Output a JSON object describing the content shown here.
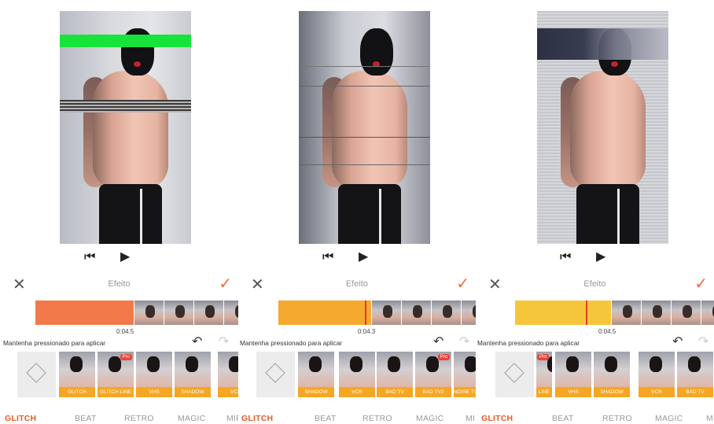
{
  "colors": {
    "accent": "#f06a3a",
    "tag": "#f5a623",
    "pro_badge": "#e8453c",
    "playhead": "#e53a2a"
  },
  "icons": {
    "close": "✕",
    "check": "✓",
    "undo": "↶",
    "redo": "↷",
    "skip_back": "⏮",
    "play": "▶"
  },
  "panels": [
    {
      "title": "Efeito",
      "time": "0:04.5",
      "hint": "Mantenha pressionado para aplicar",
      "timeline_color": "#f27a4a",
      "effects": [
        {
          "label": "GLITCH",
          "pro": ""
        },
        {
          "label": "GLITCH LINE",
          "pro": "Pro"
        },
        {
          "label": "VHS",
          "pro": ""
        },
        {
          "label": "SHADOW",
          "pro": ""
        },
        {
          "label": "VCR",
          "pro": ""
        }
      ],
      "categories": [
        "GLITCH",
        "BEAT",
        "RETRO",
        "MAGIC",
        "MIR"
      ]
    },
    {
      "title": "Efeito",
      "time": "0:04.3",
      "hint": "Mantenha pressionado para aplicar",
      "timeline_color": "#f5a92e",
      "effects": [
        {
          "label": "SHADOW",
          "pro": ""
        },
        {
          "label": "VCR",
          "pro": ""
        },
        {
          "label": "BAD TV",
          "pro": ""
        },
        {
          "label": "BAD TV2",
          "pro": "Pro"
        },
        {
          "label": "NOISE TV",
          "pro": ""
        }
      ],
      "categories": [
        "GLITCH",
        "BEAT",
        "RETRO",
        "MAGIC",
        "MIR"
      ]
    },
    {
      "title": "Efeito",
      "time": "0:04.5",
      "hint": "Mantenha pressionado para aplicar",
      "timeline_color": "#f6c63a",
      "effects": [
        {
          "label": "LINE",
          "pro": "Pro"
        },
        {
          "label": "VHS",
          "pro": ""
        },
        {
          "label": "SHADOW",
          "pro": ""
        },
        {
          "label": "VCR",
          "pro": ""
        },
        {
          "label": "BAD TV",
          "pro": ""
        }
      ],
      "categories": [
        "GLITCH",
        "BEAT",
        "RETRO",
        "MAGIC",
        "M"
      ]
    }
  ]
}
